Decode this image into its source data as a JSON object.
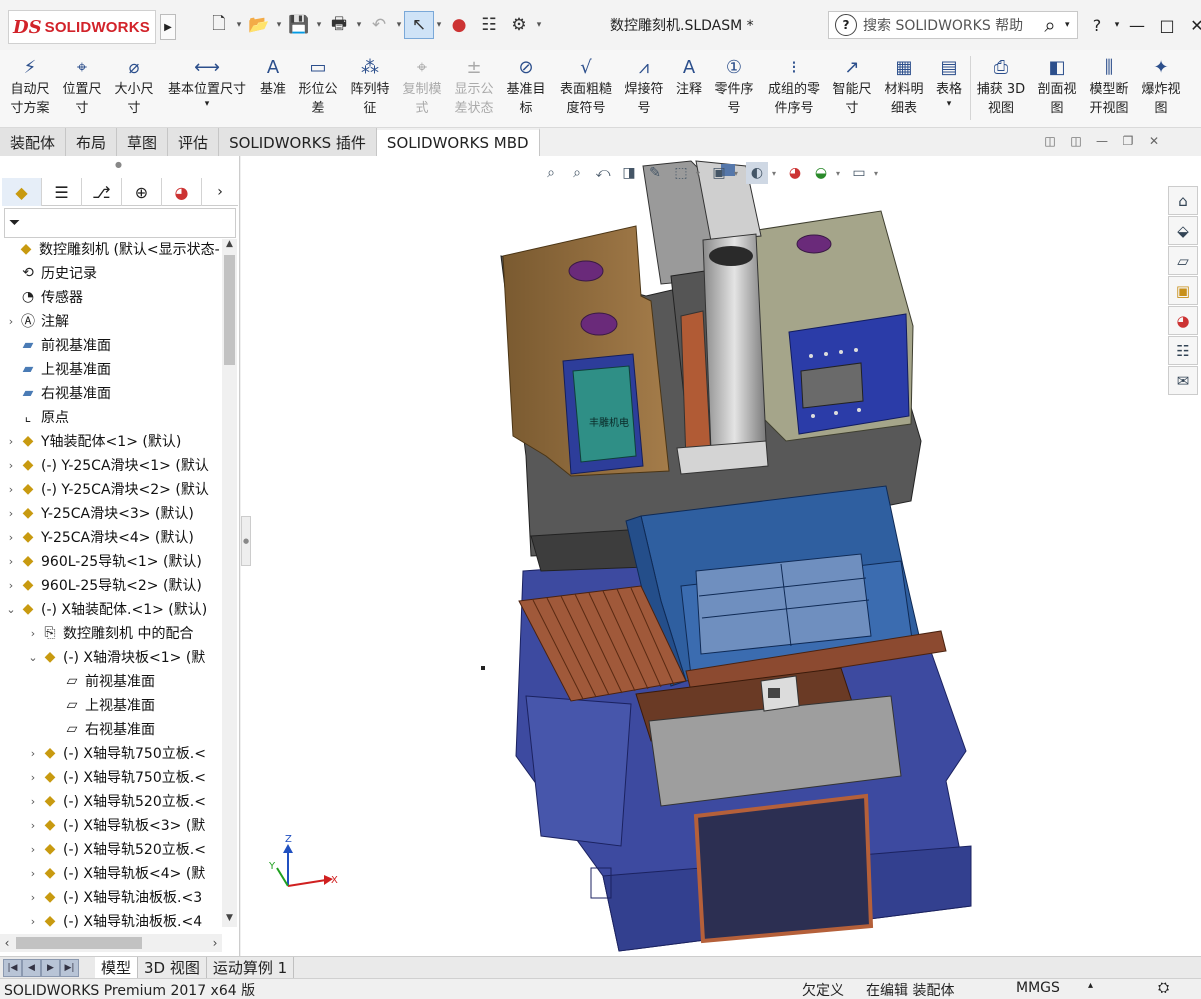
{
  "app": {
    "logo_ds": "DS",
    "logo_text": "SOLIDWORKS",
    "document_title": "数控雕刻机.SLDASM *",
    "help_search_placeholder": "搜索 SOLIDWORKS 帮助",
    "help_menu": "?",
    "window_controls": [
      "—",
      "□",
      "✕"
    ]
  },
  "command_manager": [
    {
      "label": "自动尺\n寸方案",
      "icon": "auto-dimension-icon",
      "enabled": true
    },
    {
      "label": "位置尺\n寸",
      "icon": "location-dimension-icon",
      "enabled": true
    },
    {
      "label": "大小尺\n寸",
      "icon": "size-dimension-icon",
      "enabled": true
    },
    {
      "label": "基本位置尺寸",
      "icon": "basic-location-dimension-icon",
      "enabled": true
    },
    {
      "label": "基准",
      "icon": "datum-icon",
      "enabled": true
    },
    {
      "label": "形位公\n差",
      "icon": "geometric-tolerance-icon",
      "enabled": true
    },
    {
      "label": "阵列特\n征",
      "icon": "pattern-feature-icon",
      "enabled": true
    },
    {
      "label": "复制模\n式",
      "icon": "copy-scheme-icon",
      "enabled": false
    },
    {
      "label": "显示公\n差状态",
      "icon": "show-tolerance-status-icon",
      "enabled": false
    },
    {
      "label": "基准目\n标",
      "icon": "datum-target-icon",
      "enabled": true
    },
    {
      "label": "表面粗糙\n度符号",
      "icon": "surface-finish-icon",
      "enabled": true
    },
    {
      "label": "焊接符\n号",
      "icon": "weld-symbol-icon",
      "enabled": true
    },
    {
      "label": "注释",
      "icon": "note-icon",
      "enabled": true
    },
    {
      "label": "零件序\n号",
      "icon": "balloon-icon",
      "enabled": true
    },
    {
      "label": "成组的零\n件序号",
      "icon": "stacked-balloon-icon",
      "enabled": true
    },
    {
      "label": "智能尺\n寸",
      "icon": "smart-dimension-icon",
      "enabled": true
    },
    {
      "label": "材料明\n细表",
      "icon": "bill-of-materials-icon",
      "enabled": true
    },
    {
      "label": "表格",
      "icon": "table-icon",
      "enabled": true
    },
    {
      "label": "捕获 3D\n视图",
      "icon": "capture-3d-view-icon",
      "enabled": true
    },
    {
      "label": "剖面视\n图",
      "icon": "section-view-icon",
      "enabled": true
    },
    {
      "label": "模型断\n开视图",
      "icon": "model-break-view-icon",
      "enabled": true
    },
    {
      "label": "爆炸视\n图",
      "icon": "exploded-view-icon",
      "enabled": true
    }
  ],
  "tabs": [
    {
      "label": "装配体",
      "active": false
    },
    {
      "label": "布局",
      "active": false
    },
    {
      "label": "草图",
      "active": false
    },
    {
      "label": "评估",
      "active": false
    },
    {
      "label": "SOLIDWORKS 插件",
      "active": false
    },
    {
      "label": "SOLIDWORKS MBD",
      "active": true
    }
  ],
  "tree": [
    {
      "label": "数控雕刻机 (默认<显示状态-",
      "icon": "assembly-icon",
      "level": 0,
      "toggle": ""
    },
    {
      "label": "历史记录",
      "icon": "history-icon",
      "level": 1,
      "toggle": ""
    },
    {
      "label": "传感器",
      "icon": "sensor-icon",
      "level": 1,
      "toggle": ""
    },
    {
      "label": "注解",
      "icon": "annotation-icon",
      "level": 1,
      "toggle": "›"
    },
    {
      "label": "前视基准面",
      "icon": "plane-icon",
      "level": 1,
      "toggle": ""
    },
    {
      "label": "上视基准面",
      "icon": "plane-icon",
      "level": 1,
      "toggle": ""
    },
    {
      "label": "右视基准面",
      "icon": "plane-icon",
      "level": 1,
      "toggle": ""
    },
    {
      "label": "原点",
      "icon": "origin-icon",
      "level": 1,
      "toggle": ""
    },
    {
      "label": "Y轴装配体<1> (默认)",
      "icon": "assembly-icon",
      "level": 1,
      "toggle": "›"
    },
    {
      "label": "(-) Y-25CA滑块<1> (默认",
      "icon": "assembly-icon",
      "level": 1,
      "toggle": "›"
    },
    {
      "label": "(-) Y-25CA滑块<2> (默认",
      "icon": "assembly-icon",
      "level": 1,
      "toggle": "›"
    },
    {
      "label": "Y-25CA滑块<3> (默认)",
      "icon": "assembly-icon",
      "level": 1,
      "toggle": "›"
    },
    {
      "label": "Y-25CA滑块<4> (默认)",
      "icon": "assembly-icon",
      "level": 1,
      "toggle": "›"
    },
    {
      "label": "960L-25导轨<1> (默认)",
      "icon": "assembly-icon",
      "level": 1,
      "toggle": "›"
    },
    {
      "label": "960L-25导轨<2> (默认)",
      "icon": "assembly-icon",
      "level": 1,
      "toggle": "›"
    },
    {
      "label": "(-) X轴装配体.<1> (默认)",
      "icon": "assembly-icon",
      "level": 1,
      "toggle": "⌄"
    },
    {
      "label": "数控雕刻机 中的配合",
      "icon": "mates-icon",
      "level": 2,
      "toggle": "›"
    },
    {
      "label": "(-) X轴滑块板<1> (默",
      "icon": "part-icon",
      "level": 2,
      "toggle": "⌄"
    },
    {
      "label": "前视基准面",
      "icon": "plane-outline-icon",
      "level": 3,
      "toggle": ""
    },
    {
      "label": "上视基准面",
      "icon": "plane-outline-icon",
      "level": 3,
      "toggle": ""
    },
    {
      "label": "右视基准面",
      "icon": "plane-outline-icon",
      "level": 3,
      "toggle": ""
    },
    {
      "label": "(-) X轴导轨750立板.<",
      "icon": "part-icon",
      "level": 2,
      "toggle": "›"
    },
    {
      "label": "(-) X轴导轨750立板.<",
      "icon": "part-icon",
      "level": 2,
      "toggle": "›"
    },
    {
      "label": "(-) X轴导轨520立板.<",
      "icon": "part-icon",
      "level": 2,
      "toggle": "›"
    },
    {
      "label": "(-) X轴导轨板<3> (默",
      "icon": "part-icon",
      "level": 2,
      "toggle": "›"
    },
    {
      "label": "(-) X轴导轨520立板.<",
      "icon": "part-icon",
      "level": 2,
      "toggle": "›"
    },
    {
      "label": "(-) X轴导轨板<4> (默",
      "icon": "part-icon",
      "level": 2,
      "toggle": "›"
    },
    {
      "label": "(-) X轴导轨油板板.<3",
      "icon": "part-icon",
      "level": 2,
      "toggle": "›"
    },
    {
      "label": "(-) X轴导轨油板板.<4",
      "icon": "part-icon",
      "level": 2,
      "toggle": "›"
    }
  ],
  "model": {
    "control_box_label": "丰雕机电",
    "triad": {
      "x": "X",
      "y": "Y",
      "z": "Z"
    }
  },
  "bottom_tabs": [
    {
      "label": "模型",
      "active": true
    },
    {
      "label": "3D 视图",
      "active": false
    },
    {
      "label": "运动算例 1",
      "active": false
    }
  ],
  "status": {
    "product": "SOLIDWORKS Premium 2017 x64 版",
    "definition": "欠定义",
    "mode": "在编辑 装配体",
    "units": "MMGS"
  },
  "colors": {
    "accent_red": "#d2232a",
    "base_blue": "#3d4aa0",
    "table_blue": "#2f5fa0",
    "housing_brown": "#8c6a3c",
    "control_box_olive": "#a5a58a",
    "frame_gray": "#5b5b5b"
  }
}
